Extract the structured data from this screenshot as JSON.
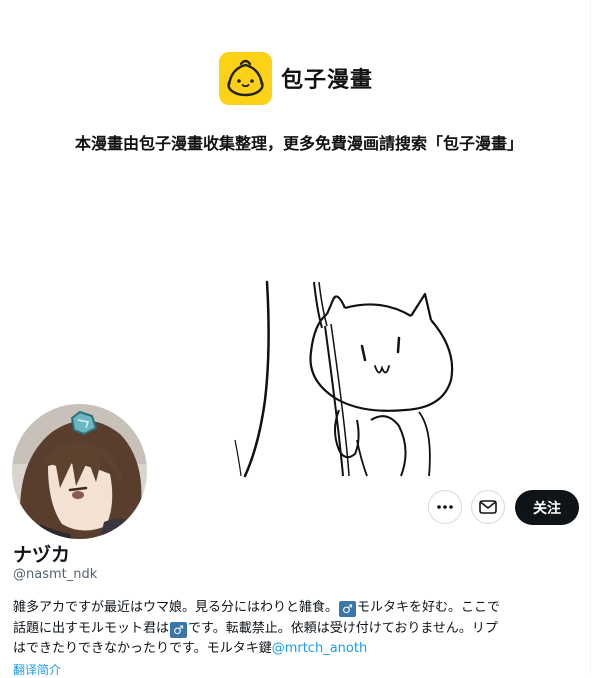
{
  "header": {
    "site_title": "包子漫畫",
    "notice": "本漫畫由包子漫畫收集整理，更多免費漫画請搜索「包子漫畫」"
  },
  "profile": {
    "display_name": "ナヅカ",
    "handle": "@nasmt_ndk",
    "follow_label": "关注",
    "bio": {
      "line1_a": "雑多アカですが最近はウマ娘。見る分にはわりと雑食。",
      "male_symbol": "♂",
      "line1_b": "モルタキを好む。ここで",
      "line2_a": "話題に出すモルモット君は",
      "line2_b": "です。転載禁止。依頼は受け付けておりません。リプ",
      "line3_a": "はできたりできなかったりです。モルタキ鍵",
      "mention": "@mrtch_anoth"
    },
    "translate_label": "翻译简介"
  },
  "colors": {
    "logo_yellow": "#fcd116",
    "follow_bg": "#0f1419",
    "link_blue": "#1d9bf0",
    "handle_gray": "#536471"
  },
  "icons": [
    "bun-logo-icon",
    "more-icon",
    "mail-icon"
  ]
}
